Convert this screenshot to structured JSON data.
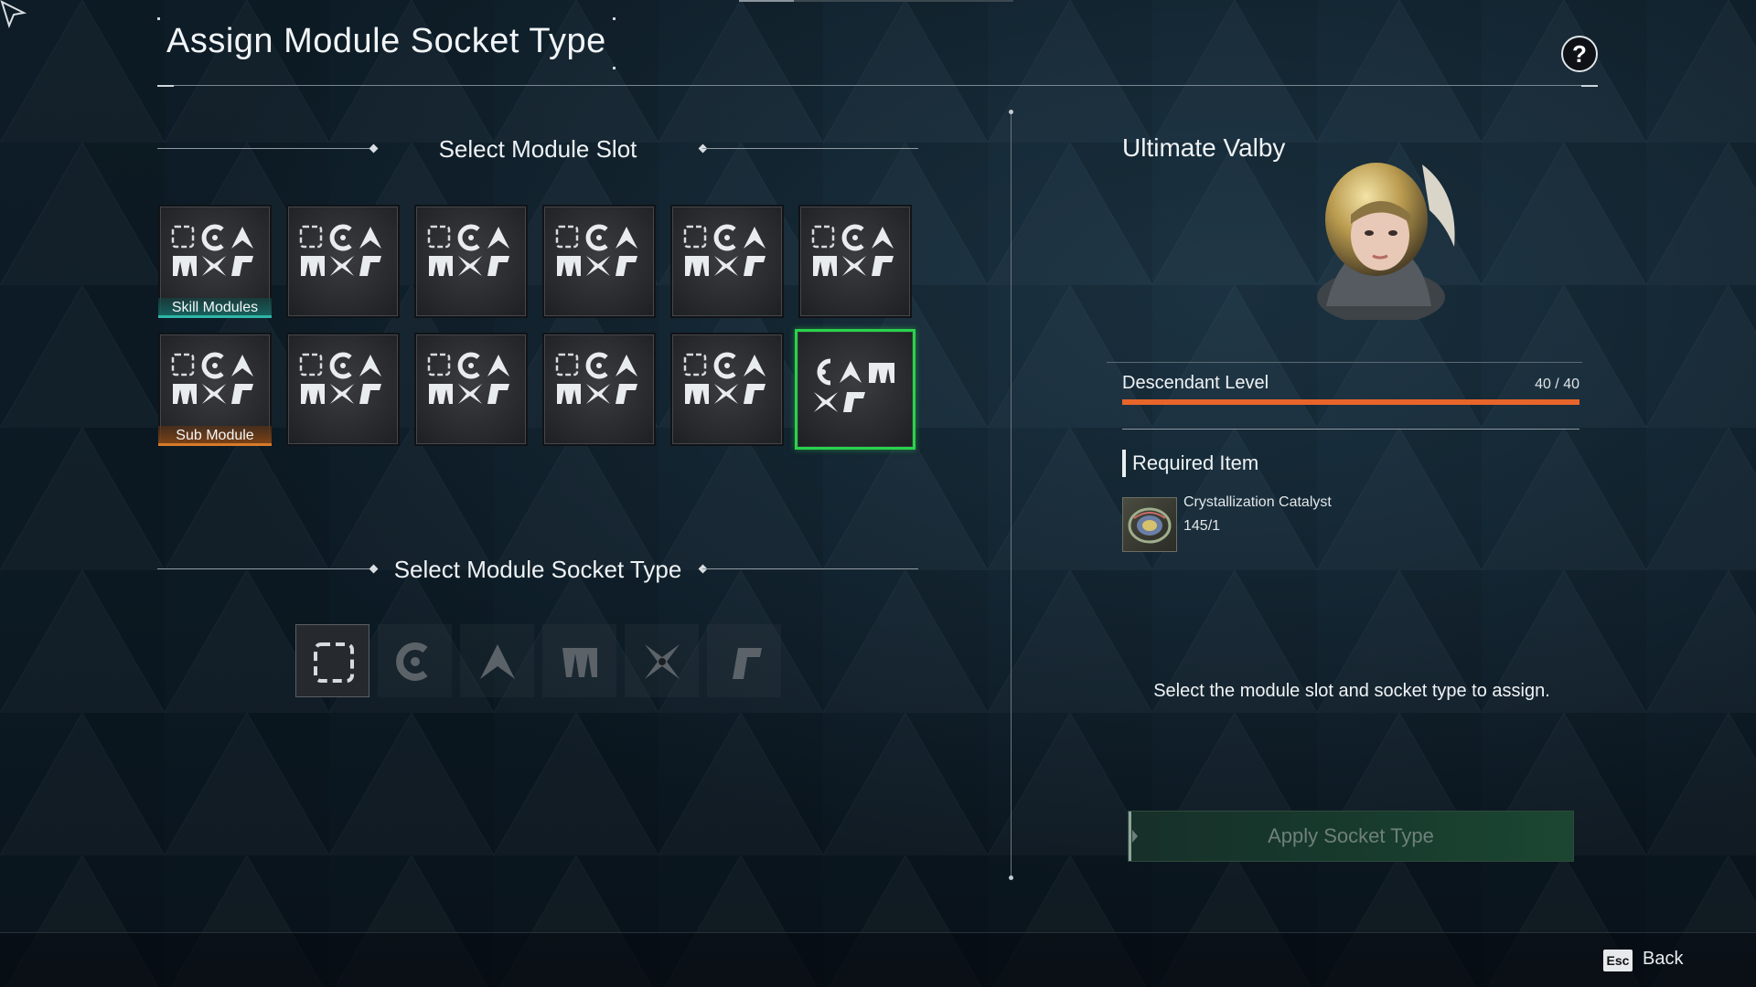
{
  "header": {
    "title": "Assign Module Socket Type",
    "help_label": "?"
  },
  "module_slot_section": {
    "title": "Select Module Slot",
    "row1_tag": "Skill Modules",
    "row2_tag": "Sub Module",
    "selected_slot": 11
  },
  "socket_type_section": {
    "title": "Select Module Socket Type",
    "socket_types": [
      "empty-socket",
      "cerulean-socket",
      "almandine-socket",
      "malachite-socket",
      "xantic-socket",
      "rutile-socket"
    ],
    "active_index": 0
  },
  "descendant": {
    "name": "Ultimate Valby",
    "level_label": "Descendant Level",
    "level_value": "40 / 40",
    "level_fraction": 1.0
  },
  "required_item": {
    "title": "Required Item",
    "name": "Crystallization Catalyst",
    "count": "145/1"
  },
  "hint": "Select the module slot and socket type to assign.",
  "apply_label": "Apply Socket Type",
  "footer": {
    "esc_key": "Esc",
    "back_label": "Back"
  },
  "colors": {
    "selected_border": "#2ad24c",
    "skill_tag": "#2fb6a6",
    "sub_tag": "#d77a2a",
    "level_bar": "#e7652a",
    "apply_button": "#1c4632"
  }
}
